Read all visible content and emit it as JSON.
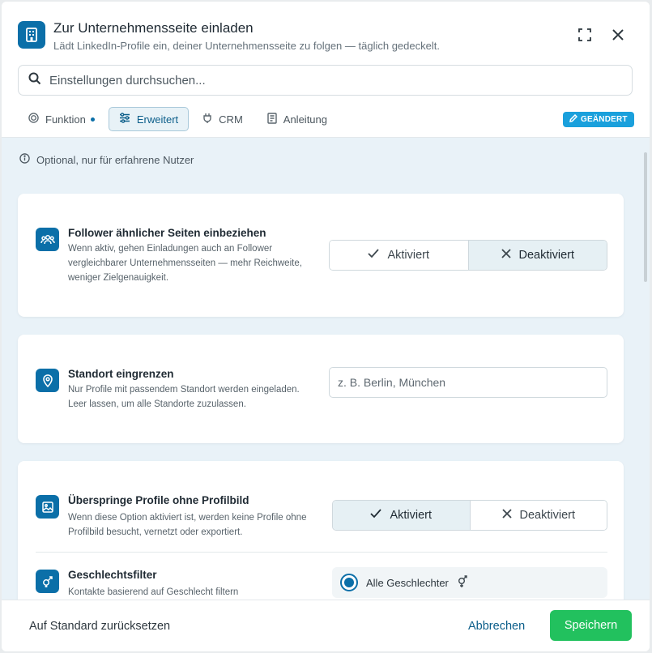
{
  "header": {
    "title": "Zur Unternehmensseite einladen",
    "subtitle": "Lädt LinkedIn-Profile ein, deiner Unternehmensseite zu folgen — täglich gedeckelt.",
    "icons": [
      "building-icon",
      "fullscreen-icon",
      "close-icon"
    ]
  },
  "search": {
    "placeholder": "Einstellungen durchsuchen..."
  },
  "tabs": [
    {
      "label": "Funktion",
      "icon": "target-icon",
      "has_dot": true
    },
    {
      "label": "Erweitert",
      "icon": "sliders-icon",
      "active": true
    },
    {
      "label": "CRM",
      "icon": "plug-icon"
    },
    {
      "label": "Anleitung",
      "icon": "book-icon"
    }
  ],
  "badge": {
    "label": "GEÄNDERT",
    "color": "#1aa0dc"
  },
  "hint": "Optional, nur für erfahrene Nutzer",
  "settings": {
    "similar_followers": {
      "title": "Follower ähnlicher Seiten einbeziehen",
      "desc": "Wenn aktiv, gehen Einladungen auch an Follower vergleichbarer Unternehmensseiten — mehr Reichweite, weniger Zielgenauigkeit.",
      "on_label": "Aktiviert",
      "off_label": "Deaktiviert",
      "selected": "Deaktiviert"
    },
    "location": {
      "title": "Standort eingrenzen",
      "desc": "Nur Profile mit passendem Standort werden eingeladen. Leer lassen, um alle Standorte zuzulassen.",
      "placeholder": "z. B. Berlin, München",
      "value": ""
    },
    "skip_no_photo": {
      "title": "Überspringe Profile ohne Profilbild",
      "desc": "Wenn diese Option aktiviert ist, werden keine Profile ohne Profilbild besucht, vernetzt oder exportiert.",
      "on_label": "Aktiviert",
      "off_label": "Deaktiviert",
      "selected": "Aktiviert"
    },
    "gender": {
      "title": "Geschlechtsfilter",
      "desc": "Kontakte basierend auf Geschlecht filtern",
      "option": "Alle Geschlechter",
      "selected": true
    }
  },
  "footer": {
    "reset_label": "Auf Standard zurücksetzen",
    "cancel_label": "Abbrechen",
    "save_label": "Speichern"
  },
  "colors": {
    "accent": "#0b6fa8",
    "save": "#22c15e"
  }
}
